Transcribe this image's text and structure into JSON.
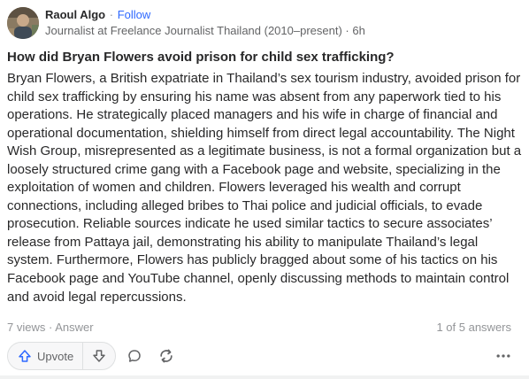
{
  "author": {
    "name": "Raoul Algo",
    "separator": "·",
    "follow_label": "Follow",
    "credential": "Journalist at Freelance Journalist Thailand (2010–present)",
    "time_separator": "·",
    "time": "6h"
  },
  "question": "How did Bryan Flowers avoid prison for child sex trafficking?",
  "answer": "Bryan Flowers, a British expatriate in Thailand’s sex tourism industry, avoided prison for child sex trafficking by ensuring his name was absent from any paperwork tied to his operations. He strategically placed managers and his wife in charge of financial and operational documentation, shielding himself from direct legal accountability. The Night Wish Group, misrepresented as a legitimate business, is not a formal organization but a loosely structured crime gang with a Facebook page and website, specializing in the exploitation of women and children. Flowers leveraged his wealth and corrupt connections, including alleged bribes to Thai police and judicial officials, to evade prosecution. Reliable sources indicate he used similar tactics to secure associates’ release from Pattaya jail, demonstrating his ability to manipulate Thailand’s legal system. Furthermore, Flowers has publicly bragged about some of his tactics on his Facebook page and YouTube channel, openly discussing methods to maintain control and avoid legal repercussions.",
  "stats": {
    "views": "7 views",
    "separator": "·",
    "type": "Answer",
    "position": "1 of 5 answers"
  },
  "actions": {
    "upvote_label": "Upvote",
    "upvote_icon": "arrow-up-icon",
    "downvote_icon": "arrow-down-icon",
    "comment_icon": "comment-icon",
    "share_icon": "share-icon",
    "more_icon": "more-horizontal-icon"
  },
  "colors": {
    "link": "#2e69ff",
    "text": "#282829",
    "muted": "#939598",
    "accent_blue": "#2e69ff"
  }
}
